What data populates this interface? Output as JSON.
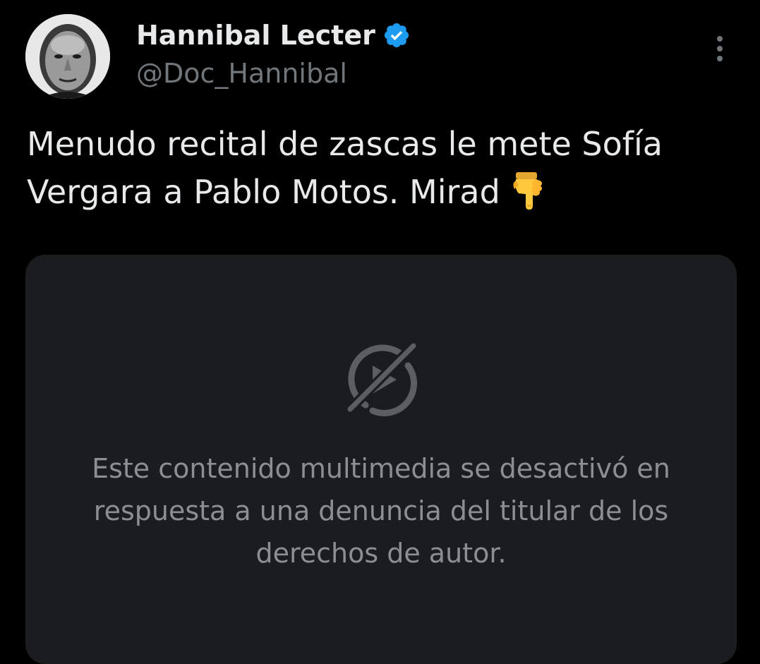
{
  "tweet": {
    "author": {
      "display_name": "Hannibal Lecter",
      "handle": "@Doc_Hannibal",
      "verified": true,
      "avatar_icon": "profile-photo"
    },
    "text": "Menudo recital de zascas le mete Sofía Vergara a Pablo Motos. Mirad",
    "text_emoji": "backhand-index-pointing-down-emoji",
    "more_icon": "more-vertical-icon"
  },
  "media": {
    "icon": "media-disabled-icon",
    "notice": "Este contenido multimedia se desactivó en respuesta a una denuncia del titular de los derechos de autor."
  },
  "colors": {
    "background": "#000000",
    "text_primary": "#e7e9ea",
    "text_secondary": "#71767b",
    "verified_blue": "#1d9bf0",
    "card_background": "#1b1c1f",
    "notice_text": "#8b8f94"
  }
}
